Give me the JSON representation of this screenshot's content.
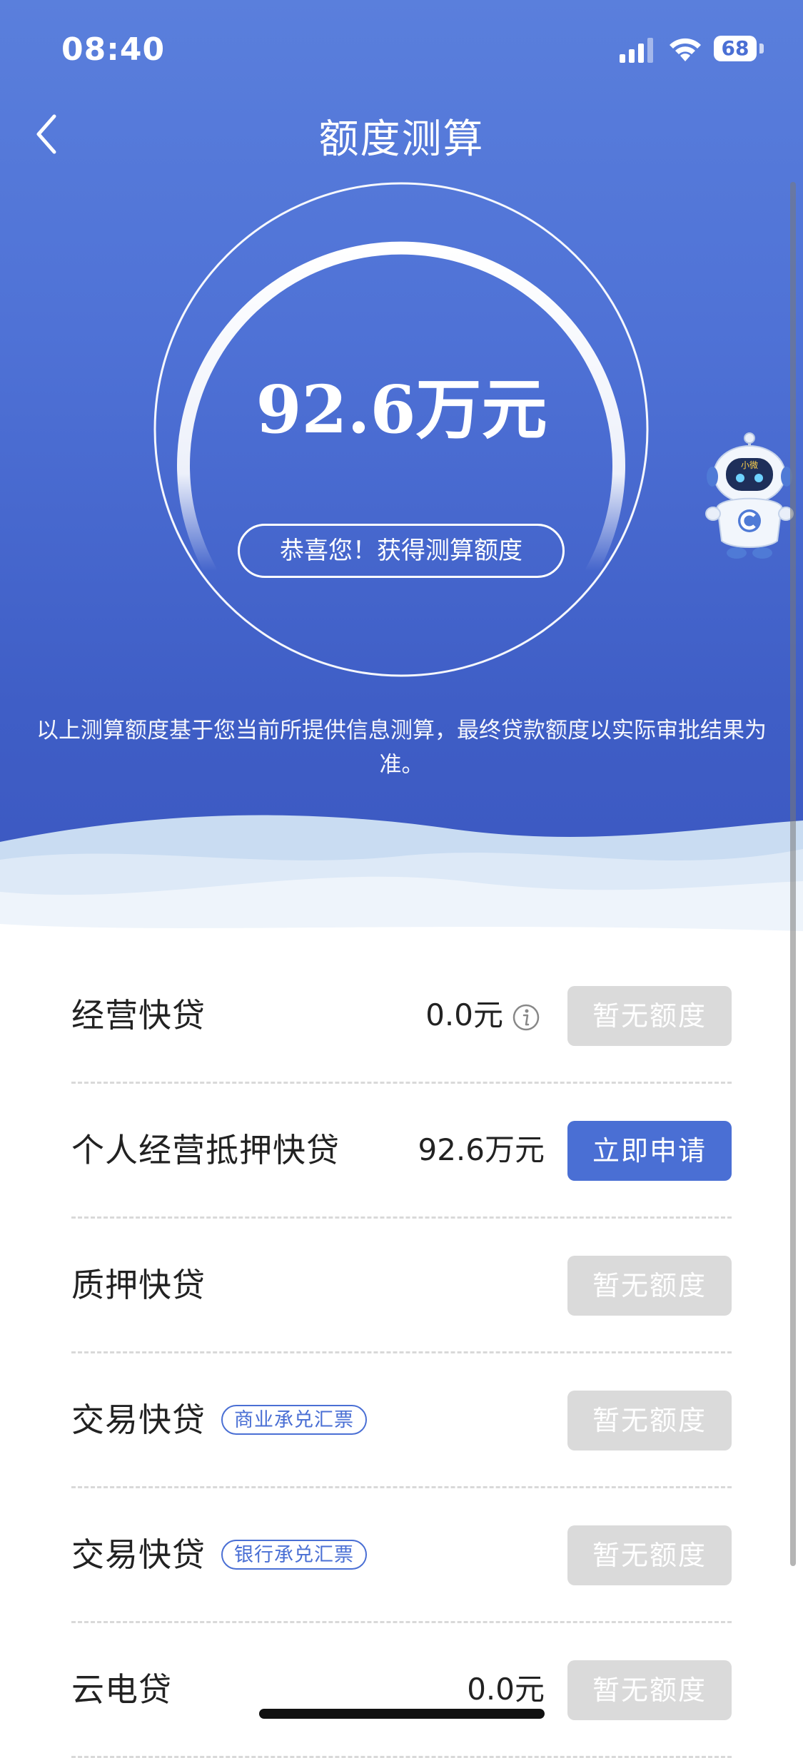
{
  "status_bar": {
    "time": "08:40",
    "battery": "68"
  },
  "header": {
    "title": "额度测算"
  },
  "result": {
    "amount": "92.6万元",
    "congrats": "恭喜您！获得测算额度",
    "disclaimer": "以上测算额度基于您当前所提供信息测算，最终贷款额度以实际审批结果为准。"
  },
  "mascot": {
    "badge_text": "小微"
  },
  "products": [
    {
      "name": "经营快贷",
      "tag": "",
      "amount": "0.0元",
      "info": true,
      "button": "暂无额度",
      "enabled": false
    },
    {
      "name": "个人经营抵押快贷",
      "tag": "",
      "amount": "92.6万元",
      "info": false,
      "button": "立即申请",
      "enabled": true
    },
    {
      "name": "质押快贷",
      "tag": "",
      "amount": "",
      "info": false,
      "button": "暂无额度",
      "enabled": false
    },
    {
      "name": "交易快贷",
      "tag": "商业承兑汇票",
      "amount": "",
      "info": false,
      "button": "暂无额度",
      "enabled": false
    },
    {
      "name": "交易快贷",
      "tag": "银行承兑汇票",
      "amount": "",
      "info": false,
      "button": "暂无额度",
      "enabled": false
    },
    {
      "name": "云电贷",
      "tag": "",
      "amount": "0.0元",
      "info": false,
      "button": "暂无额度",
      "enabled": false
    }
  ],
  "colors": {
    "primary": "#4a6fd4",
    "disabled": "#dadada",
    "hero_top": "#5a7fdc",
    "hero_bottom": "#3b57c0"
  }
}
